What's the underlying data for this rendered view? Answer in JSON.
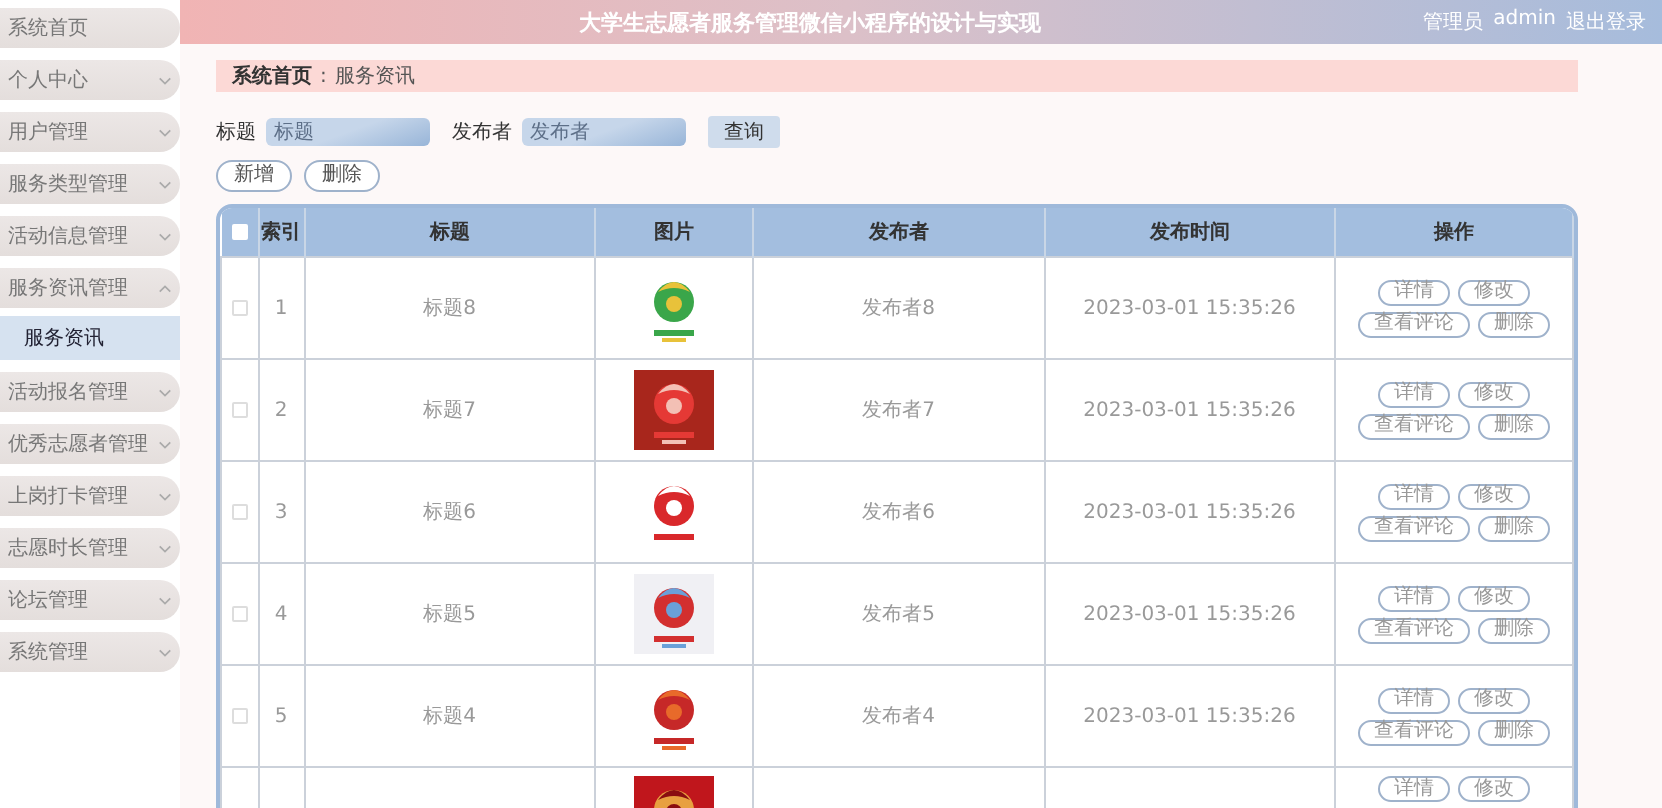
{
  "header": {
    "title": "大学生志愿者服务管理微信小程序的设计与实现",
    "user_role": "管理员",
    "user_name": "admin",
    "logout": "退出登录"
  },
  "sidebar": {
    "items": [
      {
        "label": "系统首页",
        "selected": false
      },
      {
        "label": "个人中心",
        "selected": false,
        "expanded": false
      },
      {
        "label": "用户管理",
        "selected": false,
        "expanded": false
      },
      {
        "label": "服务类型管理",
        "selected": false,
        "expanded": false
      },
      {
        "label": "活动信息管理",
        "selected": false,
        "expanded": false
      },
      {
        "label": "服务资讯管理",
        "selected": false,
        "expanded": true,
        "children": [
          {
            "label": "服务资讯",
            "selected": true
          }
        ]
      },
      {
        "label": "活动报名管理",
        "selected": false,
        "expanded": false
      },
      {
        "label": "优秀志愿者管理",
        "selected": false,
        "expanded": false
      },
      {
        "label": "上岗打卡管理",
        "selected": false,
        "expanded": false
      },
      {
        "label": "志愿时长管理",
        "selected": false,
        "expanded": false
      },
      {
        "label": "论坛管理",
        "selected": false,
        "expanded": false
      },
      {
        "label": "系统管理",
        "selected": false,
        "expanded": false
      }
    ]
  },
  "breadcrumb": [
    "系统首页",
    "服务资讯"
  ],
  "breadcrumb_separator": ":",
  "search": {
    "fields": [
      {
        "label": "标题",
        "placeholder": "标题"
      },
      {
        "label": "发布者",
        "placeholder": "发布者"
      }
    ],
    "button": "查询"
  },
  "actions": [
    "新增",
    "删除"
  ],
  "table": {
    "header_checked": false,
    "columns": [
      "索引",
      "标题",
      "图片",
      "发布者",
      "发布时间",
      "操作"
    ],
    "rows": [
      {
        "checked": false,
        "index": "1",
        "title": "标题8",
        "publisher": "发布者8",
        "time": "2023-03-01 15:35:26",
        "buttons": [
          "详情",
          "修改",
          "查看评论",
          "删除"
        ]
      },
      {
        "checked": false,
        "index": "2",
        "title": "标题7",
        "publisher": "发布者7",
        "time": "2023-03-01 15:35:26",
        "buttons": [
          "详情",
          "修改",
          "查看评论",
          "删除"
        ]
      },
      {
        "checked": false,
        "index": "3",
        "title": "标题6",
        "publisher": "发布者6",
        "time": "2023-03-01 15:35:26",
        "buttons": [
          "详情",
          "修改",
          "查看评论",
          "删除"
        ]
      },
      {
        "checked": false,
        "index": "4",
        "title": "标题5",
        "publisher": "发布者5",
        "time": "2023-03-01 15:35:26",
        "buttons": [
          "详情",
          "修改",
          "查看评论",
          "删除"
        ]
      },
      {
        "checked": false,
        "index": "5",
        "title": "标题4",
        "publisher": "发布者4",
        "time": "2023-03-01 15:35:26",
        "buttons": [
          "详情",
          "修改",
          "查看评论",
          "删除"
        ]
      },
      {
        "buttons": [
          "详情",
          "修改"
        ]
      }
    ]
  }
}
